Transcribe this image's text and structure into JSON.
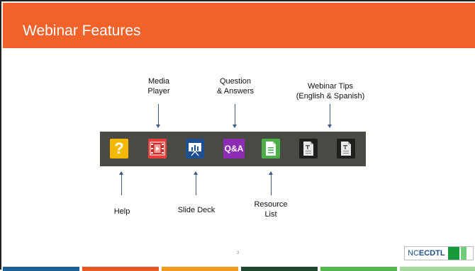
{
  "header": {
    "title": "Webinar Features"
  },
  "labels": {
    "media_player": "Media\nPlayer",
    "question_answers": "Question\n& Answers",
    "webinar_tips": "Webinar Tips\n(English & Spanish)",
    "help": "Help",
    "slide_deck": "Slide Deck",
    "resource_list": "Resource\nList"
  },
  "toolbar": {
    "help_glyph": "?",
    "qa_text": "Q&A",
    "icons": [
      "help-icon",
      "media-player-icon",
      "slide-deck-icon",
      "qa-icon",
      "resource-list-icon",
      "webinar-tips-doc-icon",
      "webinar-tips-doc-icon"
    ]
  },
  "footer": {
    "page_number": "3",
    "logo_prefix": "NC",
    "logo_bold": "ECDTL"
  },
  "colors": {
    "header": "#f1612a",
    "toolbar": "#4a4a45",
    "help": "#f5b800",
    "media": "#e7403a",
    "slides": "#1e4f91",
    "qa": "#8e2bb5",
    "resources": "#4bb04a",
    "docs": "#1e1e1e",
    "bottom_bars": [
      "#1c5f92",
      "#e85625",
      "#f09a1f",
      "#1f4730",
      "#57b54d",
      "#a5d99b"
    ]
  }
}
